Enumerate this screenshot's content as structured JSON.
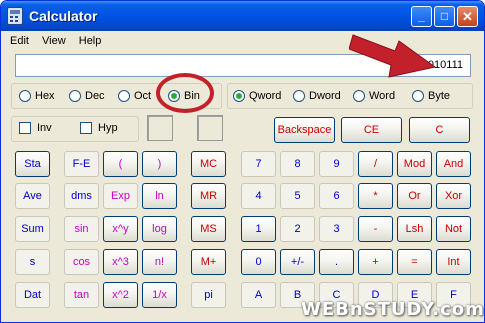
{
  "window": {
    "title": "Calculator",
    "caption_buttons": {
      "minimize": "_",
      "maximize": "□",
      "close": "✕"
    }
  },
  "menu": [
    "Edit",
    "View",
    "Help"
  ],
  "display": {
    "value": "10010111"
  },
  "number_system": [
    {
      "label": "Hex",
      "selected": false
    },
    {
      "label": "Dec",
      "selected": false
    },
    {
      "label": "Oct",
      "selected": false
    },
    {
      "label": "Bin",
      "selected": true
    }
  ],
  "word_size": [
    {
      "label": "Qword",
      "selected": true
    },
    {
      "label": "Dword",
      "selected": false
    },
    {
      "label": "Word",
      "selected": false
    },
    {
      "label": "Byte",
      "selected": false
    }
  ],
  "checkboxes": [
    {
      "label": "Inv",
      "checked": false
    },
    {
      "label": "Hyp",
      "checked": false
    }
  ],
  "edit_buttons": [
    "Backspace",
    "CE",
    "C"
  ],
  "keypad_rows": [
    [
      "Sta",
      "F-E",
      "(",
      ")",
      "MC",
      "7",
      "8",
      "9",
      "/",
      "Mod",
      "And"
    ],
    [
      "Ave",
      "dms",
      "Exp",
      "ln",
      "MR",
      "4",
      "5",
      "6",
      "*",
      "Or",
      "Xor"
    ],
    [
      "Sum",
      "sin",
      "x^y",
      "log",
      "MS",
      "1",
      "2",
      "3",
      "-",
      "Lsh",
      "Not"
    ],
    [
      "s",
      "cos",
      "x^3",
      "n!",
      "M+",
      "0",
      "+/-",
      ".",
      "+",
      "=",
      "Int"
    ],
    [
      "Dat",
      "tan",
      "x^2",
      "1/x",
      "pi",
      "A",
      "B",
      "C",
      "D",
      "E",
      "F"
    ]
  ],
  "keypad_disabled": [
    [
      false,
      true,
      false,
      false,
      false,
      true,
      true,
      true,
      false,
      false,
      false
    ],
    [
      true,
      true,
      true,
      false,
      false,
      true,
      true,
      true,
      false,
      false,
      false
    ],
    [
      true,
      true,
      false,
      false,
      false,
      false,
      true,
      true,
      false,
      false,
      false
    ],
    [
      true,
      true,
      false,
      false,
      false,
      false,
      false,
      false,
      false,
      false,
      false
    ],
    [
      true,
      true,
      false,
      false,
      true,
      true,
      true,
      true,
      true,
      true,
      true
    ]
  ],
  "keypad_colors": [
    [
      "blue",
      "blue",
      "mag",
      "mag",
      "red",
      "blue",
      "blue",
      "blue",
      "red",
      "red",
      "red"
    ],
    [
      "blue",
      "blue",
      "mag",
      "mag",
      "red",
      "blue",
      "blue",
      "blue",
      "red",
      "red",
      "red"
    ],
    [
      "blue",
      "mag",
      "mag",
      "mag",
      "red",
      "blue",
      "blue",
      "blue",
      "red",
      "red",
      "red"
    ],
    [
      "blue",
      "mag",
      "mag",
      "mag",
      "red",
      "blue",
      "blue",
      "blue",
      "red",
      "red",
      "red"
    ],
    [
      "blue",
      "mag",
      "mag",
      "mag",
      "blue",
      "blue",
      "blue",
      "blue",
      "blue",
      "blue",
      "blue"
    ]
  ],
  "watermark": "WEBnSTUDY.com",
  "colors": {
    "titlebar": "#0054e3",
    "annotation_red": "#c2202a",
    "radio_selected": "#2fa83b"
  }
}
